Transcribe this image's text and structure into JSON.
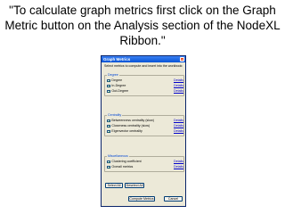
{
  "caption": "\"To calculate graph metrics first click on the Graph Metric button on the Analysis section of the NodeXL Ribbon.\"",
  "dialog": {
    "title": "Graph Metrics",
    "close_glyph": "×",
    "intro": "Select metrics to compute and insert into the workbook:",
    "details_label": "Details",
    "groups": [
      {
        "title": "Degree",
        "items": [
          {
            "label": "Degree",
            "checked": true
          },
          {
            "label": "In-Degree",
            "checked": true
          },
          {
            "label": "Out-Degree",
            "checked": true
          }
        ]
      },
      {
        "title": "Centrality",
        "items": [
          {
            "label": "Betweenness centrality  (slow)",
            "checked": true
          },
          {
            "label": "Closeness centrality  (slow)",
            "checked": true
          },
          {
            "label": "Eigenvector centrality",
            "checked": true
          }
        ]
      },
      {
        "title": "Miscellaneous",
        "items": [
          {
            "label": "Clustering coefficient",
            "checked": true
          },
          {
            "label": "Overall metrics",
            "checked": true
          }
        ]
      }
    ],
    "buttons": {
      "select_all": "Select All",
      "deselect_all": "Deselect All",
      "compute": "Compute Metrics",
      "cancel": "Cancel"
    },
    "check_glyph": "✓"
  }
}
